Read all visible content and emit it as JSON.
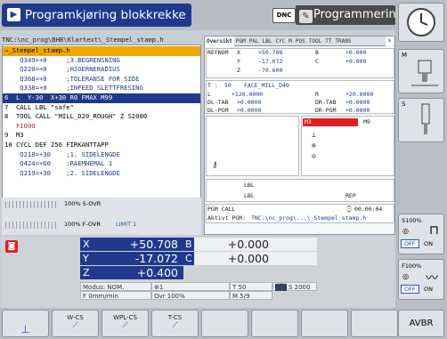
{
  "header": {
    "left_mode": "Programkjøring blokkrekke",
    "dnc": "DNC",
    "right_mode": "Programmering"
  },
  "program": {
    "path": "TNC:\\nc_prog\\BHB\\Klartext\\_Stempel_stamp.h",
    "lines": [
      "→_Stempel_stamp.h",
      "    Q349=+0     ;3.BEGRENSNING",
      "    Q220=+0     ;HJOERNERADIUS",
      "    Q368=+0     ;TOLERANSE FOR SIDE",
      "    Q338=+0     ;INFEED SLETTFRESING",
      "6  L  Y-30  X+30 R0 FMAX M99",
      "7  CALL LBL \"safe\"",
      "8  TOOL CALL \"MILL_D20_ROUGH\" Z S2000",
      "   F1000",
      "9  M3",
      "10 CYCL DEF 256 FIRKANTTAPP",
      "    Q218=+30    ;1. SIDELENGDE",
      "    Q424=+60    ;RAEMNEMAL 1",
      "    Q219=+30    ;2. SIDELENGDE"
    ]
  },
  "override": {
    "s_ovr": "100% S-OVR",
    "f_ovr": "100% F-OVR",
    "limit": "LIMIT 1"
  },
  "status": {
    "tabs": [
      "Oversikt",
      "PGM",
      "PAL",
      "LBL",
      "CYC",
      "M",
      "POS",
      "TOOL",
      "TT",
      "TRANS"
    ],
    "refnom": "REFNOM",
    "x_label": "X",
    "x": "+50.708",
    "b_label": "B",
    "b": "+0.000",
    "y_label": "Y",
    "y": "-17.072",
    "c_label": "C",
    "c": "+0.000",
    "z_label": "Z",
    "z": "-70.600",
    "t_label": "T :",
    "t_num": "50",
    "t_name": "FACE_MILL_D40",
    "l_label": "L",
    "l": "+120.0000",
    "r_label": "R",
    "r": "+20.0000",
    "dltab_label": "DL-TAB",
    "dltab": "+0.0000",
    "drtab_label": "DR-TAB",
    "drtab": "+0.0000",
    "dlpgm_label": "DL-PGM",
    "dlpgm": "+0.0000",
    "drpgm_label": "DR-PGM",
    "drpgm": "+0.0000",
    "m3": "M3",
    "m9": "M9",
    "lbl1": "LBL",
    "lbl2": "LBL",
    "rep": "REP",
    "pgm_call": "PGM CALL",
    "time": "00:00:04",
    "active_pgm_label": "Aktivt PGM:",
    "active_pgm": "TNC:\\nc_prog\\...\\_Stempel_stamp.h"
  },
  "axes": [
    {
      "name": "X",
      "value": "+50.708",
      "name2": "B",
      "value2": "+0.000"
    },
    {
      "name": "Y",
      "value": "-17.072",
      "name2": "C",
      "value2": "+0.000"
    },
    {
      "name": "Z",
      "value": "+0.400"
    }
  ],
  "info": {
    "modus": "Modus: NOM.",
    "f": "F 0mm/min",
    "ovr": "Ovr 100%",
    "t": "T 50",
    "s": "S 2000",
    "m": "M 5/9",
    "icon1": "1"
  },
  "softkeys": [
    "",
    "W-CS",
    "WPL-CS",
    "T-CS",
    "",
    "",
    "",
    "",
    ""
  ],
  "right": {
    "m": "M",
    "s": "S",
    "s100": "S100%",
    "off1": "OFF",
    "on1": "ON",
    "f100": "F100%",
    "off2": "OFF",
    "on2": "ON",
    "avbr": "AVBR"
  },
  "colors": {
    "accent": "#1f3a8c",
    "highlight": "#e02020",
    "bg": "#c9ced4"
  }
}
